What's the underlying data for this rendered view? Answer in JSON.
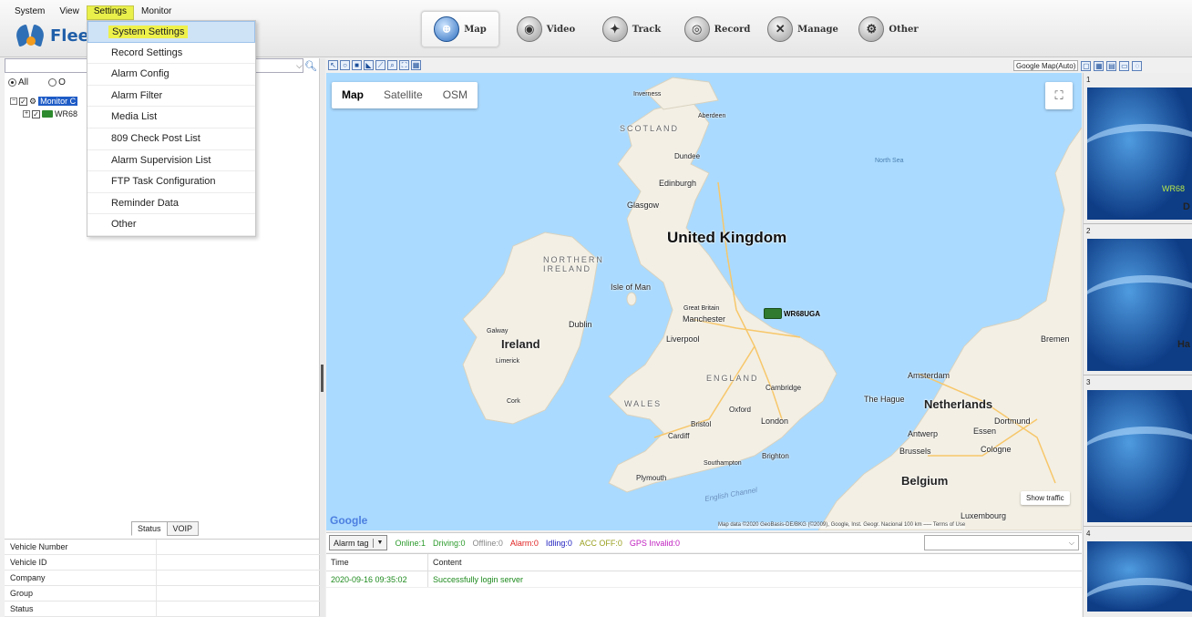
{
  "menu": [
    "System",
    "View",
    "Settings",
    "Monitor"
  ],
  "logo_text": "Fleet",
  "nav": [
    {
      "label": "Map",
      "icon": "globe-icon"
    },
    {
      "label": "Video",
      "icon": "camera-icon"
    },
    {
      "label": "Track",
      "icon": "track-icon"
    },
    {
      "label": "Record",
      "icon": "record-icon"
    },
    {
      "label": "Manage",
      "icon": "manage-icon"
    },
    {
      "label": "Other",
      "icon": "gear-icon"
    }
  ],
  "settings_menu": [
    "System Settings",
    "Record Settings",
    "Alarm Config",
    "Alarm Filter",
    "Media List",
    "809 Check Post List",
    "Alarm Supervision List",
    "FTP Task Configuration",
    "Reminder Data",
    "Other"
  ],
  "filter": {
    "all": "All",
    "other": "O"
  },
  "tree": {
    "root": "Monitor C",
    "vehicle": "WR68"
  },
  "tabs": [
    "Status",
    "VOIP"
  ],
  "info_rows": [
    "Vehicle Number",
    "Vehicle ID",
    "Company",
    "Group",
    "Status"
  ],
  "map_types": [
    "Map",
    "Satellite",
    "OSM"
  ],
  "map_provider": "Google Map(Auto)",
  "map_labels": {
    "united_kingdom": "United Kingdom",
    "ireland": "Ireland",
    "netherlands": "Netherlands",
    "belgium": "Belgium",
    "scotland": "SCOTLAND",
    "northern_ireland": "NORTHERN IRELAND",
    "england": "ENGLAND",
    "wales": "WALES",
    "north_sea": "North Sea",
    "english_channel": "English Channel",
    "isle_of_man": "Isle of Man",
    "inverness": "Inverness",
    "aberdeen": "Aberdeen",
    "dundee": "Dundee",
    "edinburgh": "Edinburgh",
    "glasgow": "Glasgow",
    "great_britain": "Great Britain",
    "manchester": "Manchester",
    "liverpool": "Liverpool",
    "dublin": "Dublin",
    "galway": "Galway",
    "limerick": "Limerick",
    "cork": "Cork",
    "cambridge": "Cambridge",
    "oxford": "Oxford",
    "london": "London",
    "bristol": "Bristol",
    "cardiff": "Cardiff",
    "brighton": "Brighton",
    "southampton": "Southampton",
    "plymouth": "Plymouth",
    "amsterdam": "Amsterdam",
    "the_hague": "The Hague",
    "antwerp": "Antwerp",
    "brussels": "Brussels",
    "essen": "Essen",
    "dortmund": "Dortmund",
    "cologne": "Cologne",
    "bremen": "Bremen",
    "luxembourg": "Luxembourg"
  },
  "vehicle_marker": "WR68UGA",
  "show_traffic": "Show traffic",
  "google": "Google",
  "attribution": "Map data ©2020 GeoBasis-DE/BKG (©2009), Google, Inst. Geogr. Nacional   100 km ⎯⎯⎯   Terms of Use",
  "status": {
    "alarm_tag": "Alarm tag",
    "online": "Online:1",
    "driving": "Driving:0",
    "offline": "Offline:0",
    "alarm": "Alarm:0",
    "idling": "Idling:0",
    "acc_off": "ACC OFF:0",
    "gps_invalid": "GPS Invalid:0"
  },
  "colors": {
    "online": "#2c9a2c",
    "driving": "#2c9a2c",
    "offline": "#888888",
    "alarm": "#e02020",
    "idling": "#2020c0",
    "acc_off": "#9aa020",
    "gps_invalid": "#c020c0"
  },
  "log": {
    "headers": [
      "Time",
      "Content"
    ],
    "rows": [
      {
        "time": "2020-09-16 09:35:02",
        "content": "Successfully login server"
      }
    ]
  },
  "video_slots": [
    {
      "num": "1",
      "edge": "",
      "plate": "WR68"
    },
    {
      "num": "2",
      "edge": "D",
      "plate": ""
    },
    {
      "num": "3",
      "edge": "Ha",
      "plate": ""
    },
    {
      "num": "4",
      "edge": "",
      "plate": ""
    }
  ]
}
